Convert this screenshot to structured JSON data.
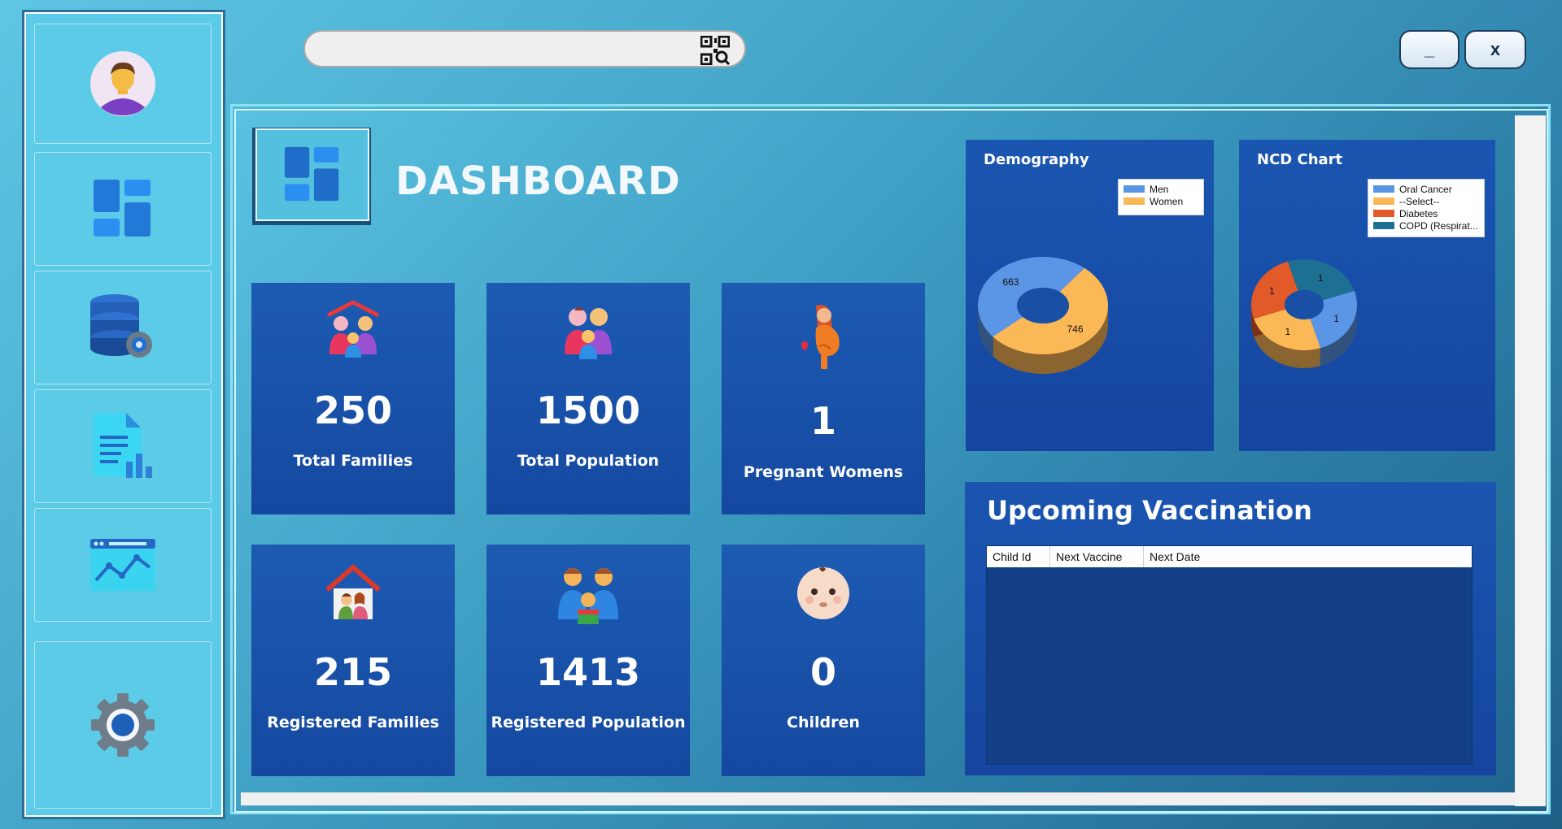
{
  "search": {
    "placeholder": "",
    "value": ""
  },
  "window_controls": {
    "minimize_label": "_",
    "close_label": "x"
  },
  "sidebar": {
    "items": [
      {
        "icon": "user-avatar-icon"
      },
      {
        "icon": "dashboard-icon"
      },
      {
        "icon": "database-settings-icon"
      },
      {
        "icon": "report-document-icon"
      },
      {
        "icon": "analytics-window-icon"
      },
      {
        "icon": "gear-icon"
      }
    ]
  },
  "header": {
    "title": "DASHBOARD"
  },
  "stats": [
    {
      "value": "250",
      "label": "Total Families",
      "icon": "family-house-icon"
    },
    {
      "value": "1500",
      "label": "Total Population",
      "icon": "family-icon"
    },
    {
      "value": "1",
      "label": "Pregnant Womens",
      "icon": "pregnant-woman-icon"
    },
    {
      "value": "215",
      "label": "Registered Families",
      "icon": "home-family-icon"
    },
    {
      "value": "1413",
      "label": "Registered Population",
      "icon": "family-group-icon"
    },
    {
      "value": "0",
      "label": "Children",
      "icon": "baby-face-icon"
    }
  ],
  "chart_data": [
    {
      "type": "pie",
      "title": "Demography",
      "categories": [
        "Men",
        "Women"
      ],
      "values": [
        663,
        746
      ],
      "colors": [
        "#5b95e6",
        "#fbb857"
      ],
      "legend": "top-right",
      "style": "3d-doughnut"
    },
    {
      "type": "pie",
      "title": "NCD Chart",
      "categories": [
        "Oral Cancer",
        "--Select--",
        "Diabetes",
        "COPD (Respirat..."
      ],
      "values": [
        1,
        1,
        1,
        1
      ],
      "colors": [
        "#5b95e6",
        "#fbb857",
        "#e25a2a",
        "#1e6f94"
      ],
      "legend": "top-right",
      "style": "3d-doughnut"
    }
  ],
  "vaccination": {
    "title": "Upcoming Vaccination",
    "columns": [
      "Child Id",
      "Next Vaccine",
      "Next Date"
    ],
    "rows": []
  }
}
